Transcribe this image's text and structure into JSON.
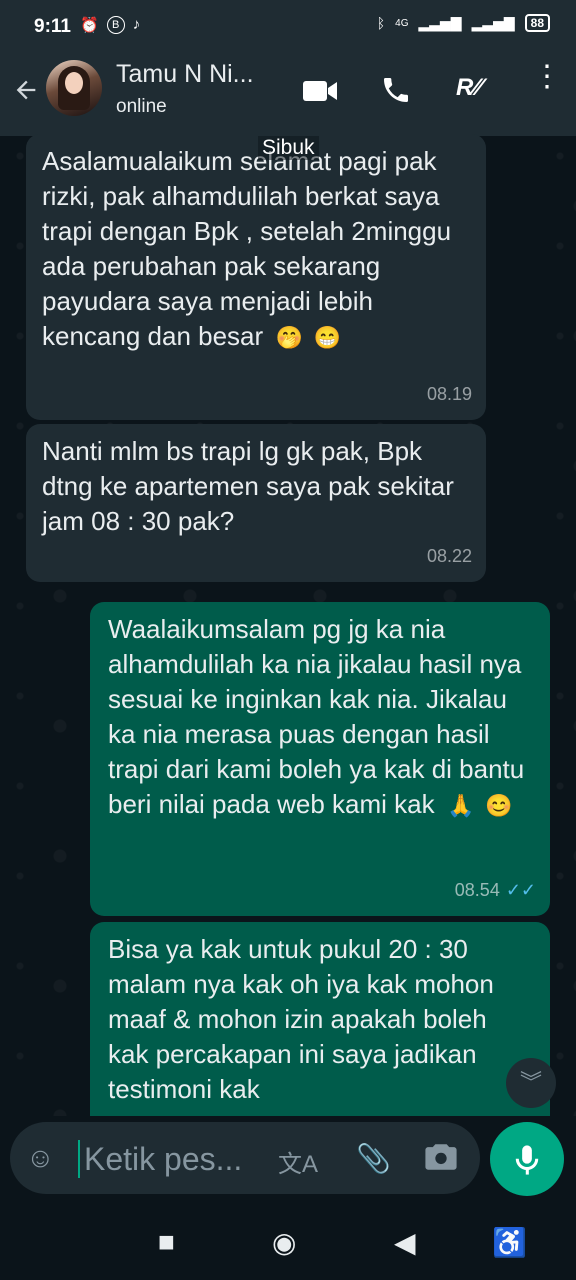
{
  "status_bar": {
    "time": "9:11",
    "signal": "4G",
    "battery": "88"
  },
  "header": {
    "back_icon": "arrow-left",
    "contact_name": "Tamu N Ni...",
    "contact_status": "online"
  },
  "overlay": {
    "sibuk_label": "Sibuk"
  },
  "messages": [
    {
      "direction": "incoming",
      "text": "Asalamualaikum selamat pagi pak rizki, pak alhamdulilah berkat saya trapi dengan Bpk , setelah 2minggu ada perubahan pak sekarang payudara saya menjadi lebih kencang dan besar",
      "emojis": [
        "🤭",
        "😁"
      ],
      "time": "08.19"
    },
    {
      "direction": "incoming",
      "text": "Nanti mlm bs trapi lg gk pak, Bpk dtng ke apartemen saya pak sekitar jam 08 : 30 pak?",
      "time": "08.22"
    },
    {
      "direction": "outgoing",
      "text": "Waalaikumsalam pg jg ka nia alhamdulilah ka nia jikalau hasil nya sesuai ke inginkan kak nia. Jikalau ka nia merasa puas dengan hasil trapi dari kami boleh ya kak di bantu beri nilai pada web kami kak",
      "emojis": [
        "🙏",
        "😊"
      ],
      "time": "08.54",
      "status": "read"
    },
    {
      "direction": "outgoing",
      "text": "Bisa ya kak untuk pukul 20 : 30 malam nya kak oh iya kak mohon maaf & mohon izin apakah boleh kak percakapan ini saya jadikan testimoni kak"
    }
  ],
  "input": {
    "placeholder": "Ketik pes..."
  },
  "colors": {
    "incoming_bubble": "#1f2c33",
    "outgoing_bubble": "#005c4b",
    "accent": "#00a884",
    "read_tick": "#53bdeb"
  }
}
